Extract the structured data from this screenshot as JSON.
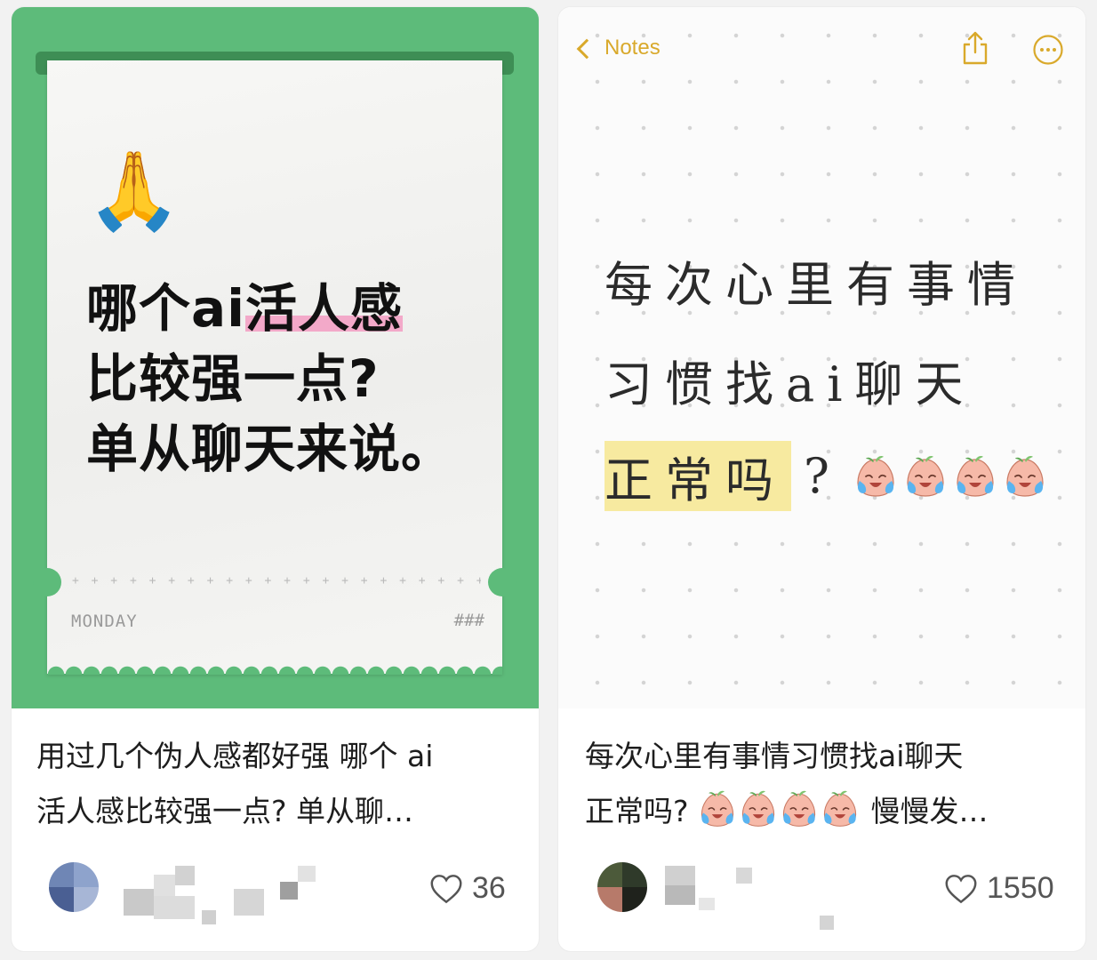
{
  "posts": [
    {
      "cover": {
        "emoji": "🙏",
        "headline": [
          "哪个ai活人感",
          "比较强一点?",
          "单从聊天来说。"
        ],
        "headline_highlight": "活人感",
        "day": "MONDAY",
        "hash": "###",
        "dots": "+ + + + + + + + + + + + + + + + + + + + + + + + + + + + + + + +",
        "bg_color": "#5dbb7a"
      },
      "caption": [
        "用过几个伪人感都好强 哪个 ai",
        "活人感比较强一点? 单从聊…"
      ],
      "likes": "36"
    },
    {
      "cover": {
        "back_label": "Notes",
        "lines": [
          "每次心里有事情",
          "习惯找ai聊天"
        ],
        "line3_highlight": "正常吗",
        "line3_tail": "?",
        "accent_color": "#d9a92b"
      },
      "caption_line1": "每次心里有事情习惯找ai聊天",
      "caption_line2_start": "正常吗?",
      "caption_line2_end": "慢慢发…",
      "likes": "1550"
    }
  ]
}
